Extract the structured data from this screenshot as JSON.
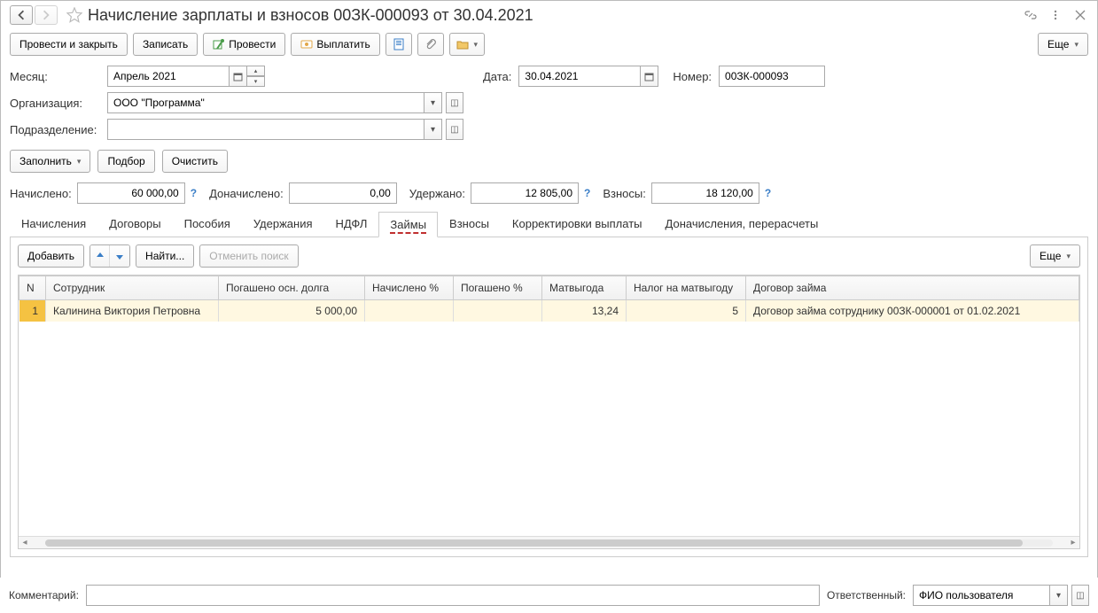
{
  "title": "Начисление зарплаты и взносов 00ЗК-000093 от 30.04.2021",
  "toolbar": {
    "post_close": "Провести и закрыть",
    "write": "Записать",
    "post": "Провести",
    "pay": "Выплатить",
    "more": "Еще"
  },
  "fields": {
    "month_label": "Месяц:",
    "month_value": "Апрель 2021",
    "date_label": "Дата:",
    "date_value": "30.04.2021",
    "number_label": "Номер:",
    "number_value": "00ЗК-000093",
    "org_label": "Организация:",
    "org_value": "ООО \"Программа\"",
    "dept_label": "Подразделение:",
    "dept_value": ""
  },
  "fill_buttons": {
    "fill": "Заполнить",
    "pick": "Подбор",
    "clear": "Очистить"
  },
  "totals": {
    "accrued_label": "Начислено:",
    "accrued_value": "60 000,00",
    "additional_label": "Доначислено:",
    "additional_value": "0,00",
    "withheld_label": "Удержано:",
    "withheld_value": "12 805,00",
    "contrib_label": "Взносы:",
    "contrib_value": "18 120,00"
  },
  "tabs": [
    "Начисления",
    "Договоры",
    "Пособия",
    "Удержания",
    "НДФЛ",
    "Займы",
    "Взносы",
    "Корректировки выплаты",
    "Доначисления, перерасчеты"
  ],
  "active_tab": 5,
  "tab_toolbar": {
    "add": "Добавить",
    "find": "Найти...",
    "cancel_find": "Отменить поиск",
    "more": "Еще"
  },
  "table": {
    "cols": [
      "N",
      "Сотрудник",
      "Погашено осн. долга",
      "Начислено %",
      "Погашено %",
      "Матвыгода",
      "Налог на матвыгоду",
      "Договор займа"
    ],
    "rows": [
      {
        "n": "1",
        "emp": "Калинина Виктория Петровна",
        "paid_main": "5 000,00",
        "accrued_pct": "",
        "paid_pct": "",
        "bonus": "13,24",
        "tax": "5",
        "contract": "Договор займа сотруднику 00ЗК-000001 от 01.02.2021"
      }
    ]
  },
  "footer": {
    "comment_label": "Комментарий:",
    "comment_value": "",
    "responsible_label": "Ответственный:",
    "responsible_value": "ФИО пользователя"
  }
}
